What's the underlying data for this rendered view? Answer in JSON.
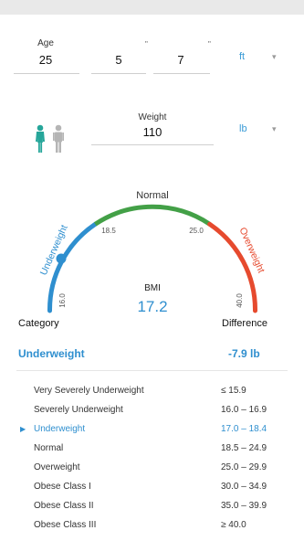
{
  "inputs": {
    "age": {
      "label": "Age",
      "value": "25"
    },
    "height": {
      "feet": "5",
      "feet_mark": "\"",
      "inches": "7",
      "inches_mark": "\"",
      "unit": "ft"
    },
    "weight": {
      "label": "Weight",
      "value": "110",
      "unit": "lb"
    }
  },
  "gauge": {
    "normal_label": "Normal",
    "underweight_label": "Underweight",
    "overweight_label": "Overweight",
    "tick_16": "16.0",
    "tick_18_5": "18.5",
    "tick_25": "25.0",
    "tick_40": "40.0",
    "bmi_label": "BMI",
    "bmi_value": "17.2",
    "min": 16.0,
    "max": 40.0,
    "pointer_value": 17.2
  },
  "summary": {
    "category_header": "Category",
    "difference_header": "Difference",
    "current_category": "Underweight",
    "difference_value": "-7.9 lb"
  },
  "categories": [
    {
      "name": "Very Severely Underweight",
      "range": "≤ 15.9"
    },
    {
      "name": "Severely Underweight",
      "range": "16.0 – 16.9"
    },
    {
      "name": "Underweight",
      "range": "17.0 – 18.4"
    },
    {
      "name": "Normal",
      "range": "18.5 – 24.9"
    },
    {
      "name": "Overweight",
      "range": "25.0 – 29.9"
    },
    {
      "name": "Obese Class I",
      "range": "30.0 – 34.9"
    },
    {
      "name": "Obese Class II",
      "range": "35.0 – 39.9"
    },
    {
      "name": "Obese Class III",
      "range": "≥ 40.0"
    }
  ],
  "colors": {
    "accent": "#2f8fcf",
    "underweight": "#2f8fcf",
    "normal": "#43a047",
    "overweight": "#e64a2e",
    "female_icon": "#26a69a",
    "male_icon": "#b5b5b5"
  }
}
